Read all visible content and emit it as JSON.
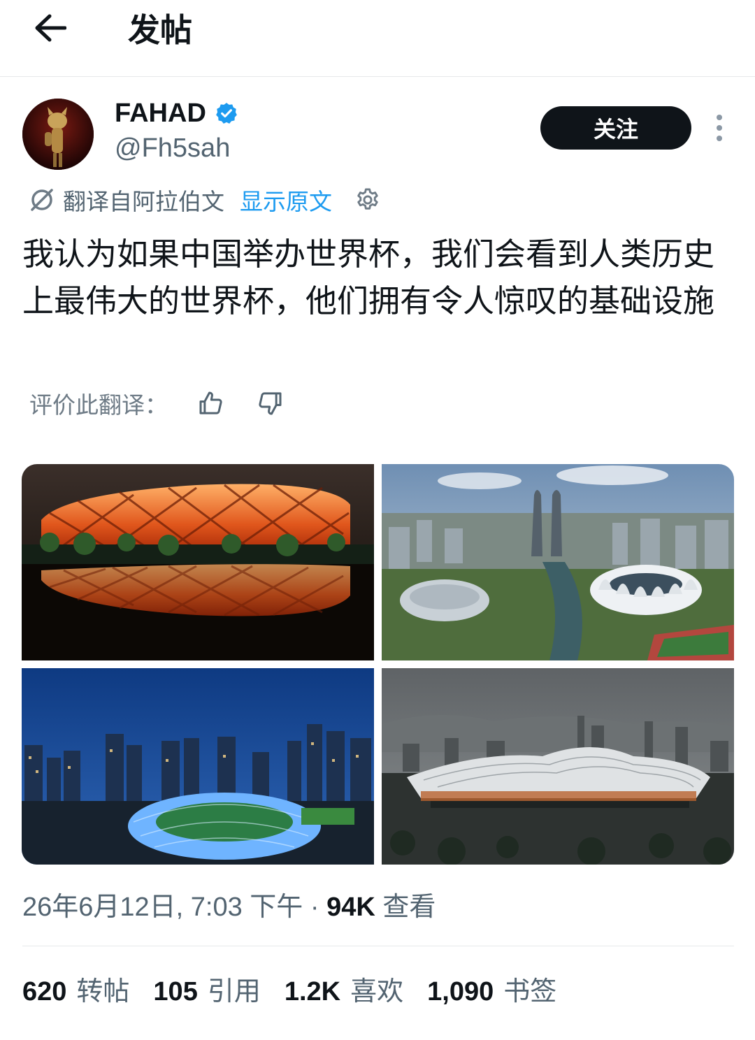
{
  "header": {
    "title": "发帖",
    "back_icon": "arrow-left-icon"
  },
  "author": {
    "display_name": "FAHAD",
    "handle": "@Fh5sah",
    "verified_icon": "verified-badge-icon",
    "verified_color": "#1d9bf0",
    "follow_label": "关注",
    "more_icon": "more-vertical-icon"
  },
  "translation": {
    "label": "翻译自阿拉伯文",
    "show_original": "显示原文",
    "settings_icon": "gear-icon"
  },
  "post": {
    "text": "我认为如果中国举办世界杯，我们会看到人类历史上最伟大的世界杯，他们拥有令人惊叹的基础设施"
  },
  "rate": {
    "label": "评价此翻译：",
    "up_icon": "thumbs-up-icon",
    "down_icon": "thumbs-down-icon"
  },
  "media": [
    {
      "name": "media-bird-nest-stadium-night"
    },
    {
      "name": "media-lotus-stadium-aerial"
    },
    {
      "name": "media-city-stadium-night"
    },
    {
      "name": "media-modern-stadium-render"
    }
  ],
  "meta": {
    "date": "26年6月12日, 7:03 下午",
    "separator": " · ",
    "views_count": "94K",
    "views_label": " 查看"
  },
  "stats": [
    {
      "num": "620",
      "label": "转帖"
    },
    {
      "num": "105",
      "label": "引用"
    },
    {
      "num": "1.2K",
      "label": "喜欢"
    },
    {
      "num": "1,090",
      "label": "书签"
    }
  ],
  "colors": {
    "accent": "#1d9bf0",
    "text": "#0f1419",
    "muted": "#536471"
  }
}
